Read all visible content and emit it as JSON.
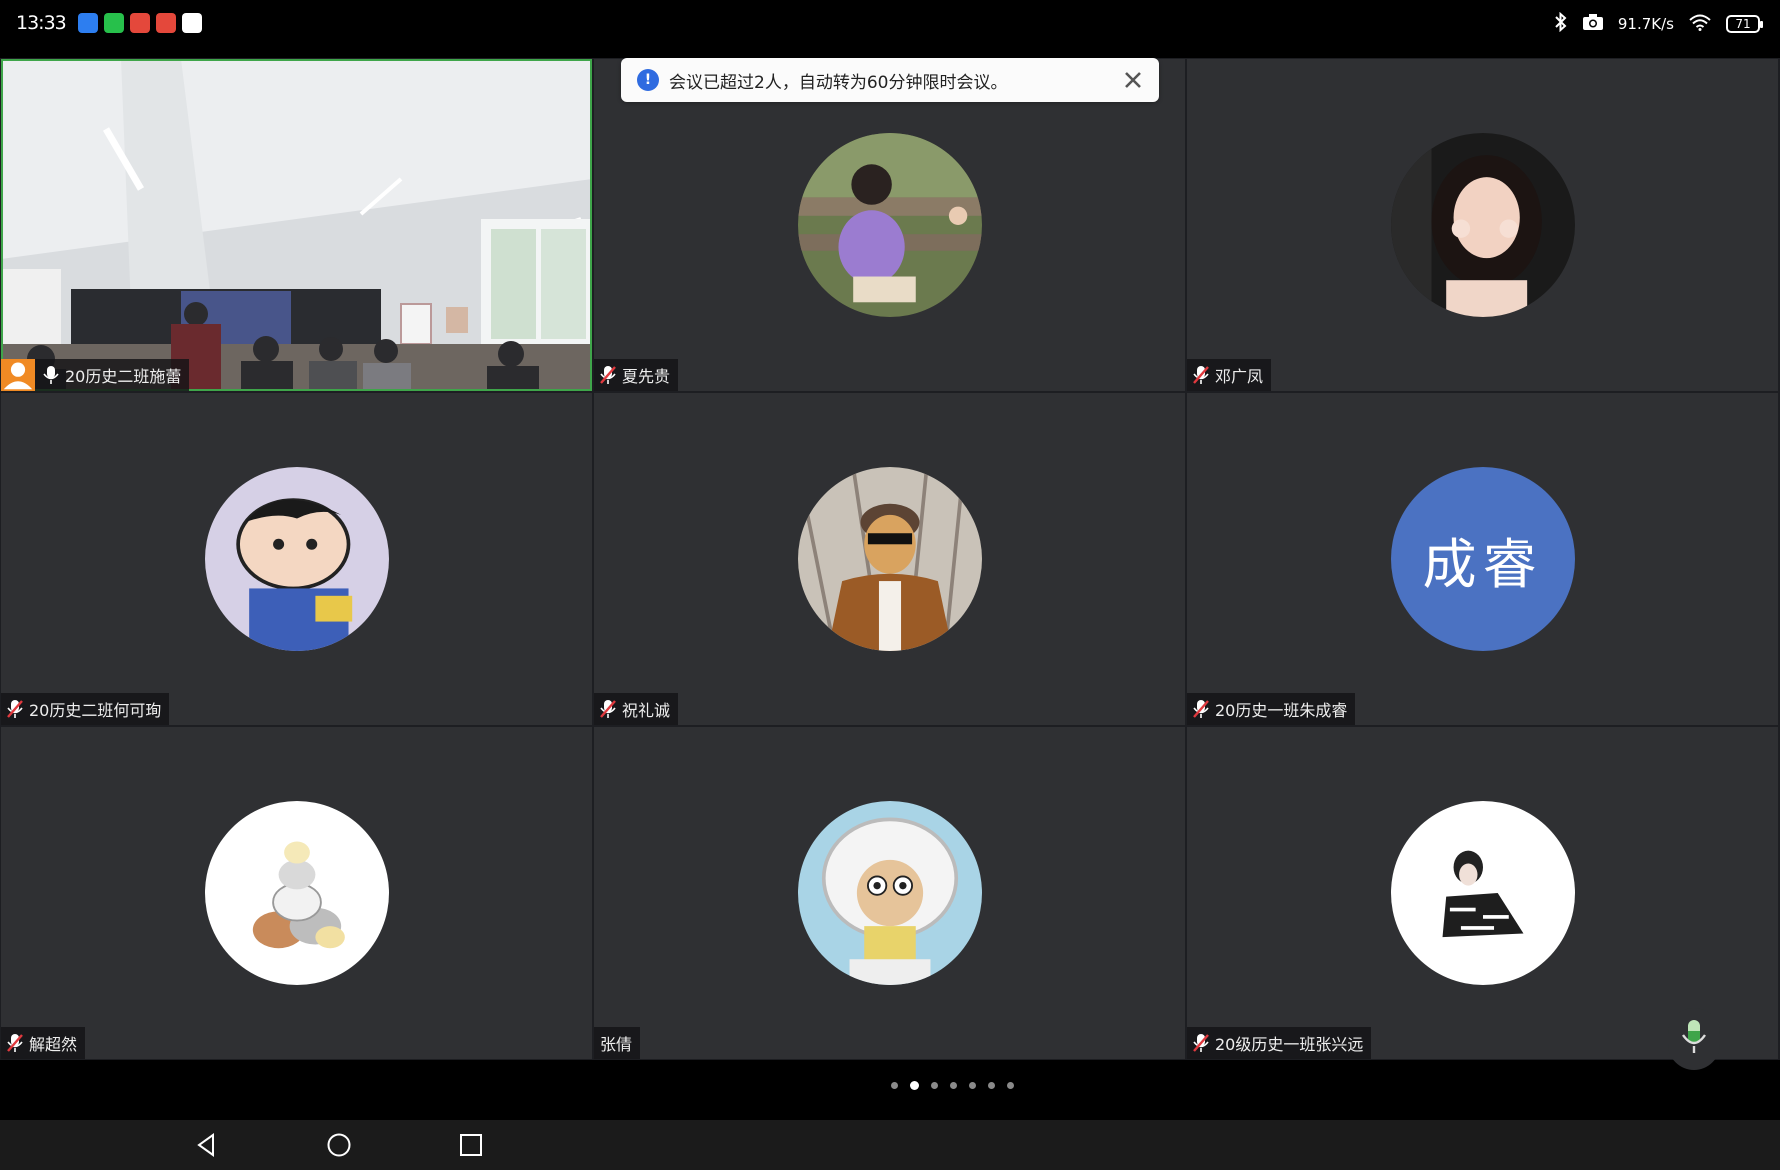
{
  "status_bar": {
    "time": "13:33",
    "network_speed": "91.7K/s",
    "battery_level": "71",
    "app_icons": [
      {
        "name": "cloud-app-icon",
        "color": "#2d7ef0"
      },
      {
        "name": "wechat-icon",
        "color": "#27c04b"
      },
      {
        "name": "red-app-icon",
        "color": "#e4483b"
      },
      {
        "name": "red-app-icon-2",
        "color": "#e4483b"
      },
      {
        "name": "qq-icon",
        "color": "#ffffff"
      }
    ]
  },
  "toast": {
    "message": "会议已超过2人，自动转为60分钟限时会议。"
  },
  "participants": [
    {
      "name": "20历史二班施蕾",
      "mic": "on",
      "type": "video"
    },
    {
      "name": "夏先贵",
      "mic": "muted",
      "type": "photo"
    },
    {
      "name": "邓广凤",
      "mic": "muted",
      "type": "photo"
    },
    {
      "name": "20历史二班何可珣",
      "mic": "muted",
      "type": "photo"
    },
    {
      "name": "祝礼诚",
      "mic": "muted",
      "type": "photo"
    },
    {
      "name": "20历史一班朱成睿",
      "mic": "muted",
      "type": "text",
      "avatar_text": "成睿"
    },
    {
      "name": "解超然",
      "mic": "muted",
      "type": "photo"
    },
    {
      "name": "张倩",
      "mic": "none",
      "type": "photo"
    },
    {
      "name": "20级历史一班张兴远",
      "mic": "muted",
      "type": "photo"
    }
  ],
  "pagination": {
    "total": 7,
    "current": 2
  },
  "colors": {
    "tile_bg": "#2f3033",
    "active_border": "#3fa54a",
    "text_avatar_bg": "#4b72c2",
    "toast_icon": "#2f6be0"
  }
}
